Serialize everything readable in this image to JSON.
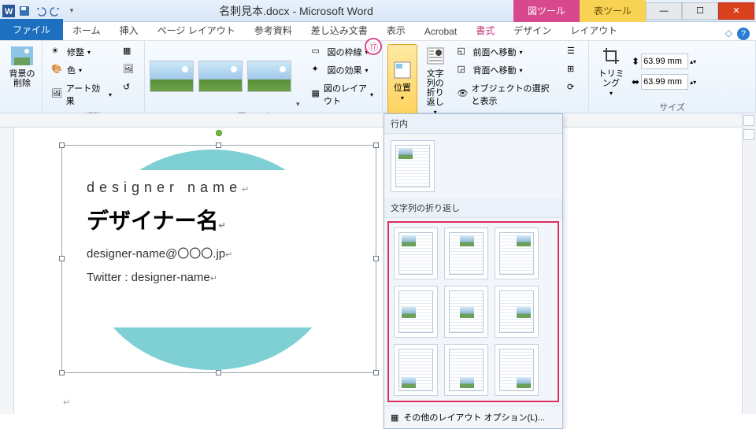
{
  "titlebar": {
    "doc_title": "名刺見本.docx - Microsoft Word",
    "tool_tab_picture": "図ツール",
    "tool_tab_table": "表ツール"
  },
  "tabs": {
    "file": "ファイル",
    "home": "ホーム",
    "insert": "挿入",
    "page_layout": "ページ レイアウト",
    "references": "参考資料",
    "mailings": "差し込み文書",
    "view": "表示",
    "acrobat": "Acrobat",
    "format": "書式",
    "design": "デザイン",
    "layout": "レイアウト"
  },
  "ribbon": {
    "remove_bg": "背景の\n削除",
    "corrections": "修整",
    "color": "色",
    "artistic": "アート効果",
    "adjust_group": "調整",
    "styles_group": "図のスタイル",
    "border": "図の枠線",
    "effects": "図の効果",
    "layout_btn": "図のレイアウト",
    "position": "位置",
    "wrap": "文字列の\n折り返し",
    "bring_fwd": "前面へ移動",
    "send_back": "背面へ移動",
    "selection_pane": "オブジェクトの選択と表示",
    "crop": "トリミング",
    "size_group": "サイズ",
    "height_val": "63.99 mm",
    "width_val": "63.99 mm"
  },
  "dropdown": {
    "inline_label": "行内",
    "wrap_label": "文字列の折り返し",
    "more_options": "その他のレイアウト オプション(L)..."
  },
  "card": {
    "line1": "designer name",
    "line2": "デザイナー名",
    "line3": "designer-name@〇〇〇.jp",
    "line4": "Twitter : designer-name"
  },
  "annotation": "⑰"
}
